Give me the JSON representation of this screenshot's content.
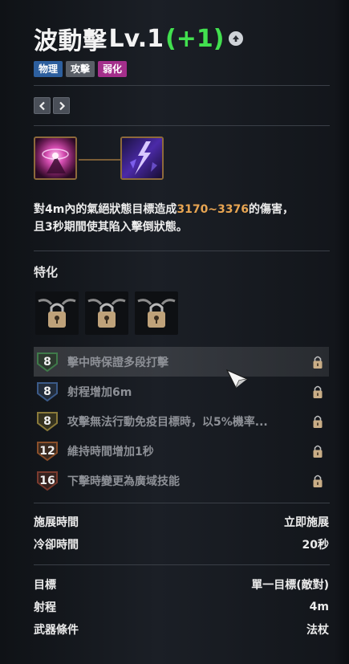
{
  "skill": {
    "name": "波動擊",
    "level": "Lv.1",
    "bonus": "(+1)"
  },
  "tags": [
    {
      "label": "物理",
      "color": "#2d5f9e"
    },
    {
      "label": "攻擊",
      "color": "#5a5f67"
    },
    {
      "label": "弱化",
      "color": "#a42f8b"
    }
  ],
  "description": {
    "line1_prefix": "對4m內的氣絕狀態目標造成",
    "damage": "3170~3376",
    "line1_suffix": "的傷害，",
    "line2": "且3秒期間使其陷入擊倒狀態。"
  },
  "specialization": {
    "title": "特化",
    "rows": [
      {
        "level": "8",
        "text": "擊中時保證多段打擊",
        "badge_color": "#3f7a4a"
      },
      {
        "level": "8",
        "text": "射程增加6m",
        "badge_color": "#3b5a88"
      },
      {
        "level": "8",
        "text": "攻擊無法行動免疫目標時，以5%機率...",
        "badge_color": "#8a7a3a"
      },
      {
        "level": "12",
        "text": "維持時間增加1秒",
        "badge_color": "#8a4f2a"
      },
      {
        "level": "16",
        "text": "下擊時變更為廣域技能",
        "badge_color": "#7a3a2e"
      }
    ]
  },
  "stats": {
    "cast_label": "施展時間",
    "cast_value": "立即施展",
    "cooldown_label": "冷卻時間",
    "cooldown_value": "20秒",
    "target_label": "目標",
    "target_value": "單一目標(敵對)",
    "range_label": "射程",
    "range_value": "4m",
    "weapon_label": "武器條件",
    "weapon_value": "法杖"
  },
  "icons": {
    "upgrade": "arrow-up-circle-icon",
    "prev": "chevron-left-icon",
    "next": "chevron-right-icon",
    "padlock": "padlock-icon",
    "chain_lock": "chained-padlock-icon"
  }
}
